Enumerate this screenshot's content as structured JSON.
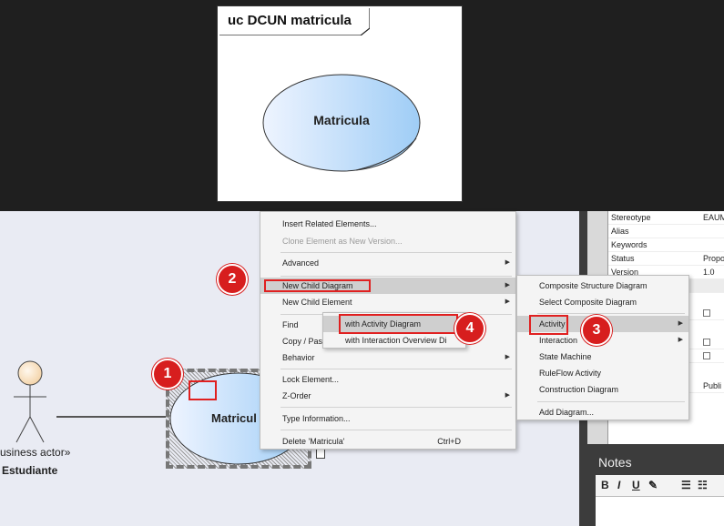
{
  "preview": {
    "title": "uc DCUN matricula",
    "usecase_name": "Matricula"
  },
  "diagram": {
    "actor_stereotype": "usiness actor»",
    "actor_name": "Estudiante",
    "usecase_name": "Matricul"
  },
  "callouts": [
    "1",
    "2",
    "3",
    "4"
  ],
  "context_menu": {
    "items": [
      {
        "label": "Insert Related Elements...",
        "disabled": false
      },
      {
        "label": "Clone Element as New Version...",
        "disabled": true
      },
      {
        "label": "Advanced",
        "submenu": true
      },
      {
        "label": "New Child Diagram",
        "submenu": true,
        "highlighted": true
      },
      {
        "label": "New Child Element",
        "submenu": true
      },
      {
        "label": "Find"
      },
      {
        "label": "Copy / Pas"
      },
      {
        "label": "Behavior",
        "submenu": true
      },
      {
        "label": "Lock Element..."
      },
      {
        "label": "Z-Order",
        "submenu": true
      },
      {
        "label": "Type Information..."
      },
      {
        "label": "Delete 'Matricula'",
        "shortcut": "Ctrl+D"
      }
    ]
  },
  "child_diagram_menu": {
    "items": [
      {
        "label": "Composite Structure Diagram"
      },
      {
        "label": "Select Composite Diagram"
      },
      {
        "label": "Activity",
        "submenu": true,
        "highlighted": true
      },
      {
        "label": "Interaction",
        "submenu": true
      },
      {
        "label": "State Machine"
      },
      {
        "label": "RuleFlow Activity"
      },
      {
        "label": "Construction Diagram"
      },
      {
        "label": "Add Diagram..."
      }
    ]
  },
  "activity_submenu": {
    "items": [
      {
        "label": "with Activity Diagram",
        "highlighted": true
      },
      {
        "label": "with Interaction Overview Di"
      }
    ]
  },
  "properties": {
    "rows": [
      {
        "key": "Stereotype",
        "value": "EAUM"
      },
      {
        "key": "Alias",
        "value": ""
      },
      {
        "key": "Keywords",
        "value": ""
      },
      {
        "key": "Status",
        "value": "Propo"
      },
      {
        "key": "Version",
        "value": "1.0"
      },
      {
        "key": "",
        "value": ""
      },
      {
        "key": "",
        "value": "",
        "checkbox": true
      },
      {
        "key": "",
        "value": ""
      },
      {
        "key": "",
        "value": "",
        "checkbox": true
      },
      {
        "key": "",
        "value": "",
        "checkbox": true
      },
      {
        "key": "",
        "value": ""
      },
      {
        "key": "",
        "value": "Publi"
      }
    ]
  },
  "notes": {
    "title": "Notes",
    "toolbar": {
      "bold": "B",
      "italic": "I",
      "underline": "U"
    }
  },
  "colors": {
    "highlight_red": "#e02020",
    "badge_red": "#d71e1e",
    "canvas_bg": "#e9ebf3",
    "ellipse_light": "#e6f0ff",
    "ellipse_blue": "#a9d1f7"
  }
}
